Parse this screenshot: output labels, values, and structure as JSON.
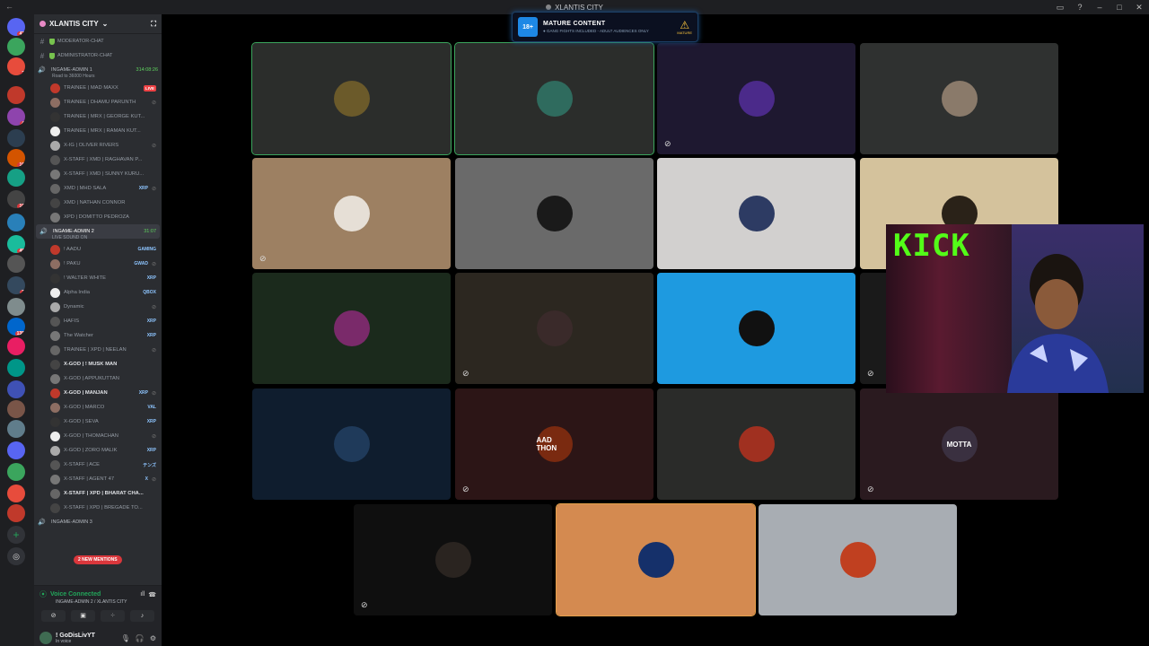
{
  "window": {
    "title": "XLANTIS CITY"
  },
  "server": {
    "name": "XLANTIS CITY"
  },
  "rail_badges": [
    "42",
    "2",
    "4",
    "16",
    "10",
    "49",
    "3",
    "135",
    "16",
    "16",
    "91",
    "172",
    "210",
    "5",
    "4"
  ],
  "channels_top": [
    {
      "name": "MODERATOR-CHAT"
    },
    {
      "name": "ADMINISTRATOR-CHAT"
    }
  ],
  "voice1": {
    "name": "INGAME-ADMIN 1",
    "time": "314:08:26",
    "subtitle": "Road to 36000 Hours",
    "users": [
      {
        "name": "TRAINEE | MAD MAXX",
        "badge": "LIVE"
      },
      {
        "name": "TRAINEE | DHAMU PARUNTH"
      },
      {
        "name": "TRAINEE | MRX | GEORGE KUT..."
      },
      {
        "name": "TRAINEE | MRX | RAMAN KUT..."
      },
      {
        "name": "X-IG | OLIVER RIVERS"
      },
      {
        "name": "X-STAFF | XMD | RAGHAVAN P..."
      },
      {
        "name": "X-STAFF | XMD | SUNNY KURU..."
      },
      {
        "name": "XMD | MHD SALA",
        "badge": "XRP"
      },
      {
        "name": "XMD | NATHAN CONNOR"
      },
      {
        "name": "XPD | DOMITTO PEDROZA"
      }
    ]
  },
  "voice2": {
    "name": "INGAME-ADMIN 2",
    "time": "31:07",
    "subtitle": "LIVE SOUND ON",
    "users": [
      {
        "name": "! AADU",
        "badge": "GAMING"
      },
      {
        "name": "! PAKU",
        "badge": "GWAD"
      },
      {
        "name": "! WALTER WHITE",
        "badge": "XRP"
      },
      {
        "name": "Alpha India",
        "badge": "QBOX"
      },
      {
        "name": "Dynamic"
      },
      {
        "name": "HAFIS",
        "badge": "XRP"
      },
      {
        "name": "The Watcher",
        "badge": "XRP"
      },
      {
        "name": "TRAINEE | XPD | NEELAN"
      },
      {
        "name": "X-GOD | ! MUSK MAN"
      },
      {
        "name": "X-GOD | APPUKUTTAN"
      },
      {
        "name": "X-GOD | MANJAN",
        "badge": "XRP"
      },
      {
        "name": "X-GOD | MARCO",
        "badge": "VAL"
      },
      {
        "name": "X-GOD | SEVA",
        "badge": "XRP"
      },
      {
        "name": "X-GOD | THOMACHAN"
      },
      {
        "name": "X-GOD | ZORO MALIK",
        "badge": "XRP"
      },
      {
        "name": "X-STAFF | ACE",
        "badge": "テンズ"
      },
      {
        "name": "X-STAFF | AGENT 47",
        "badge": "X"
      },
      {
        "name": "X-STAFF | XPD | BHARAT CHA..."
      },
      {
        "name": "X-STAFF | XPD | BREGADE TO..."
      }
    ]
  },
  "voice3": {
    "name": "INGAME-ADMIN 3"
  },
  "mentions": "2 NEW MENTIONS",
  "voice_panel": {
    "status": "Voice Connected",
    "location": "INGAME-ADMIN 2 / XLANTIS CITY"
  },
  "user_panel": {
    "name": "! GoDisLivYT",
    "status": "In voice"
  },
  "banner": {
    "badge": "18+",
    "title": "MATURE CONTENT",
    "subtitle": "● GANG FIGHTS INCLUDED - ADULT AUDIENCES ONLY",
    "warn_label": "MATURE"
  },
  "tiles": [
    {
      "bg": "#2b2d2b",
      "av": "#6b5a2a",
      "label": "",
      "speaking": true,
      "muted": false
    },
    {
      "bg": "#2b2d2b",
      "av": "#2f6b5e",
      "label": "",
      "speaking": true,
      "muted": false
    },
    {
      "bg": "#1e1830",
      "av": "#4b2a8a",
      "label": "",
      "speaking": false,
      "muted": true
    },
    {
      "bg": "#2f3130",
      "av": "#8a7a6a",
      "label": "",
      "speaking": false,
      "muted": false
    },
    {
      "bg": "#9d8062",
      "av": "#e6dfd6",
      "label": "",
      "speaking": false,
      "muted": true
    },
    {
      "bg": "#6a6a6a",
      "av": "#1a1a1a",
      "label": "",
      "speaking": false,
      "muted": false
    },
    {
      "bg": "#d2d0cf",
      "av": "#2d3b63",
      "label": "",
      "speaking": false,
      "muted": false
    },
    {
      "bg": "#d4c29c",
      "av": "#2a2218",
      "label": "",
      "speaking": false,
      "muted": false
    },
    {
      "bg": "#1b2a1c",
      "av": "#7a2a6a",
      "label": "",
      "speaking": false,
      "muted": false
    },
    {
      "bg": "#2c2720",
      "av": "#3a2a2a",
      "label": "",
      "speaking": false,
      "muted": true
    },
    {
      "bg": "#1e9ae0",
      "av": "#111",
      "label": "",
      "speaking": false,
      "muted": false
    },
    {
      "bg": "#1a1a1a",
      "av": "#111",
      "label": "",
      "speaking": false,
      "muted": true
    },
    {
      "bg": "#0f1d2e",
      "av": "#1f3a5a",
      "label": "",
      "speaking": false,
      "muted": false
    },
    {
      "bg": "#2c1516",
      "av": "#7a2a10",
      "label": "AAD THON",
      "speaking": false,
      "muted": true
    },
    {
      "bg": "#2a2b29",
      "av": "#a03020",
      "label": "",
      "speaking": false,
      "muted": false
    },
    {
      "bg": "#2a1a1f",
      "av": "#3a3040",
      "label": "MOTTA",
      "speaking": false,
      "muted": true
    },
    {
      "bg": "#0f0f0f",
      "av": "#2a2420",
      "label": "",
      "speaking": false,
      "muted": true
    },
    {
      "bg": "#d48a50",
      "av": "#15306a",
      "label": "",
      "speaking": false,
      "muted": false
    },
    {
      "bg": "#a8adb3",
      "av": "#c04020",
      "label": "",
      "speaking": false,
      "muted": false
    }
  ],
  "kick": {
    "logo": "KICK"
  }
}
